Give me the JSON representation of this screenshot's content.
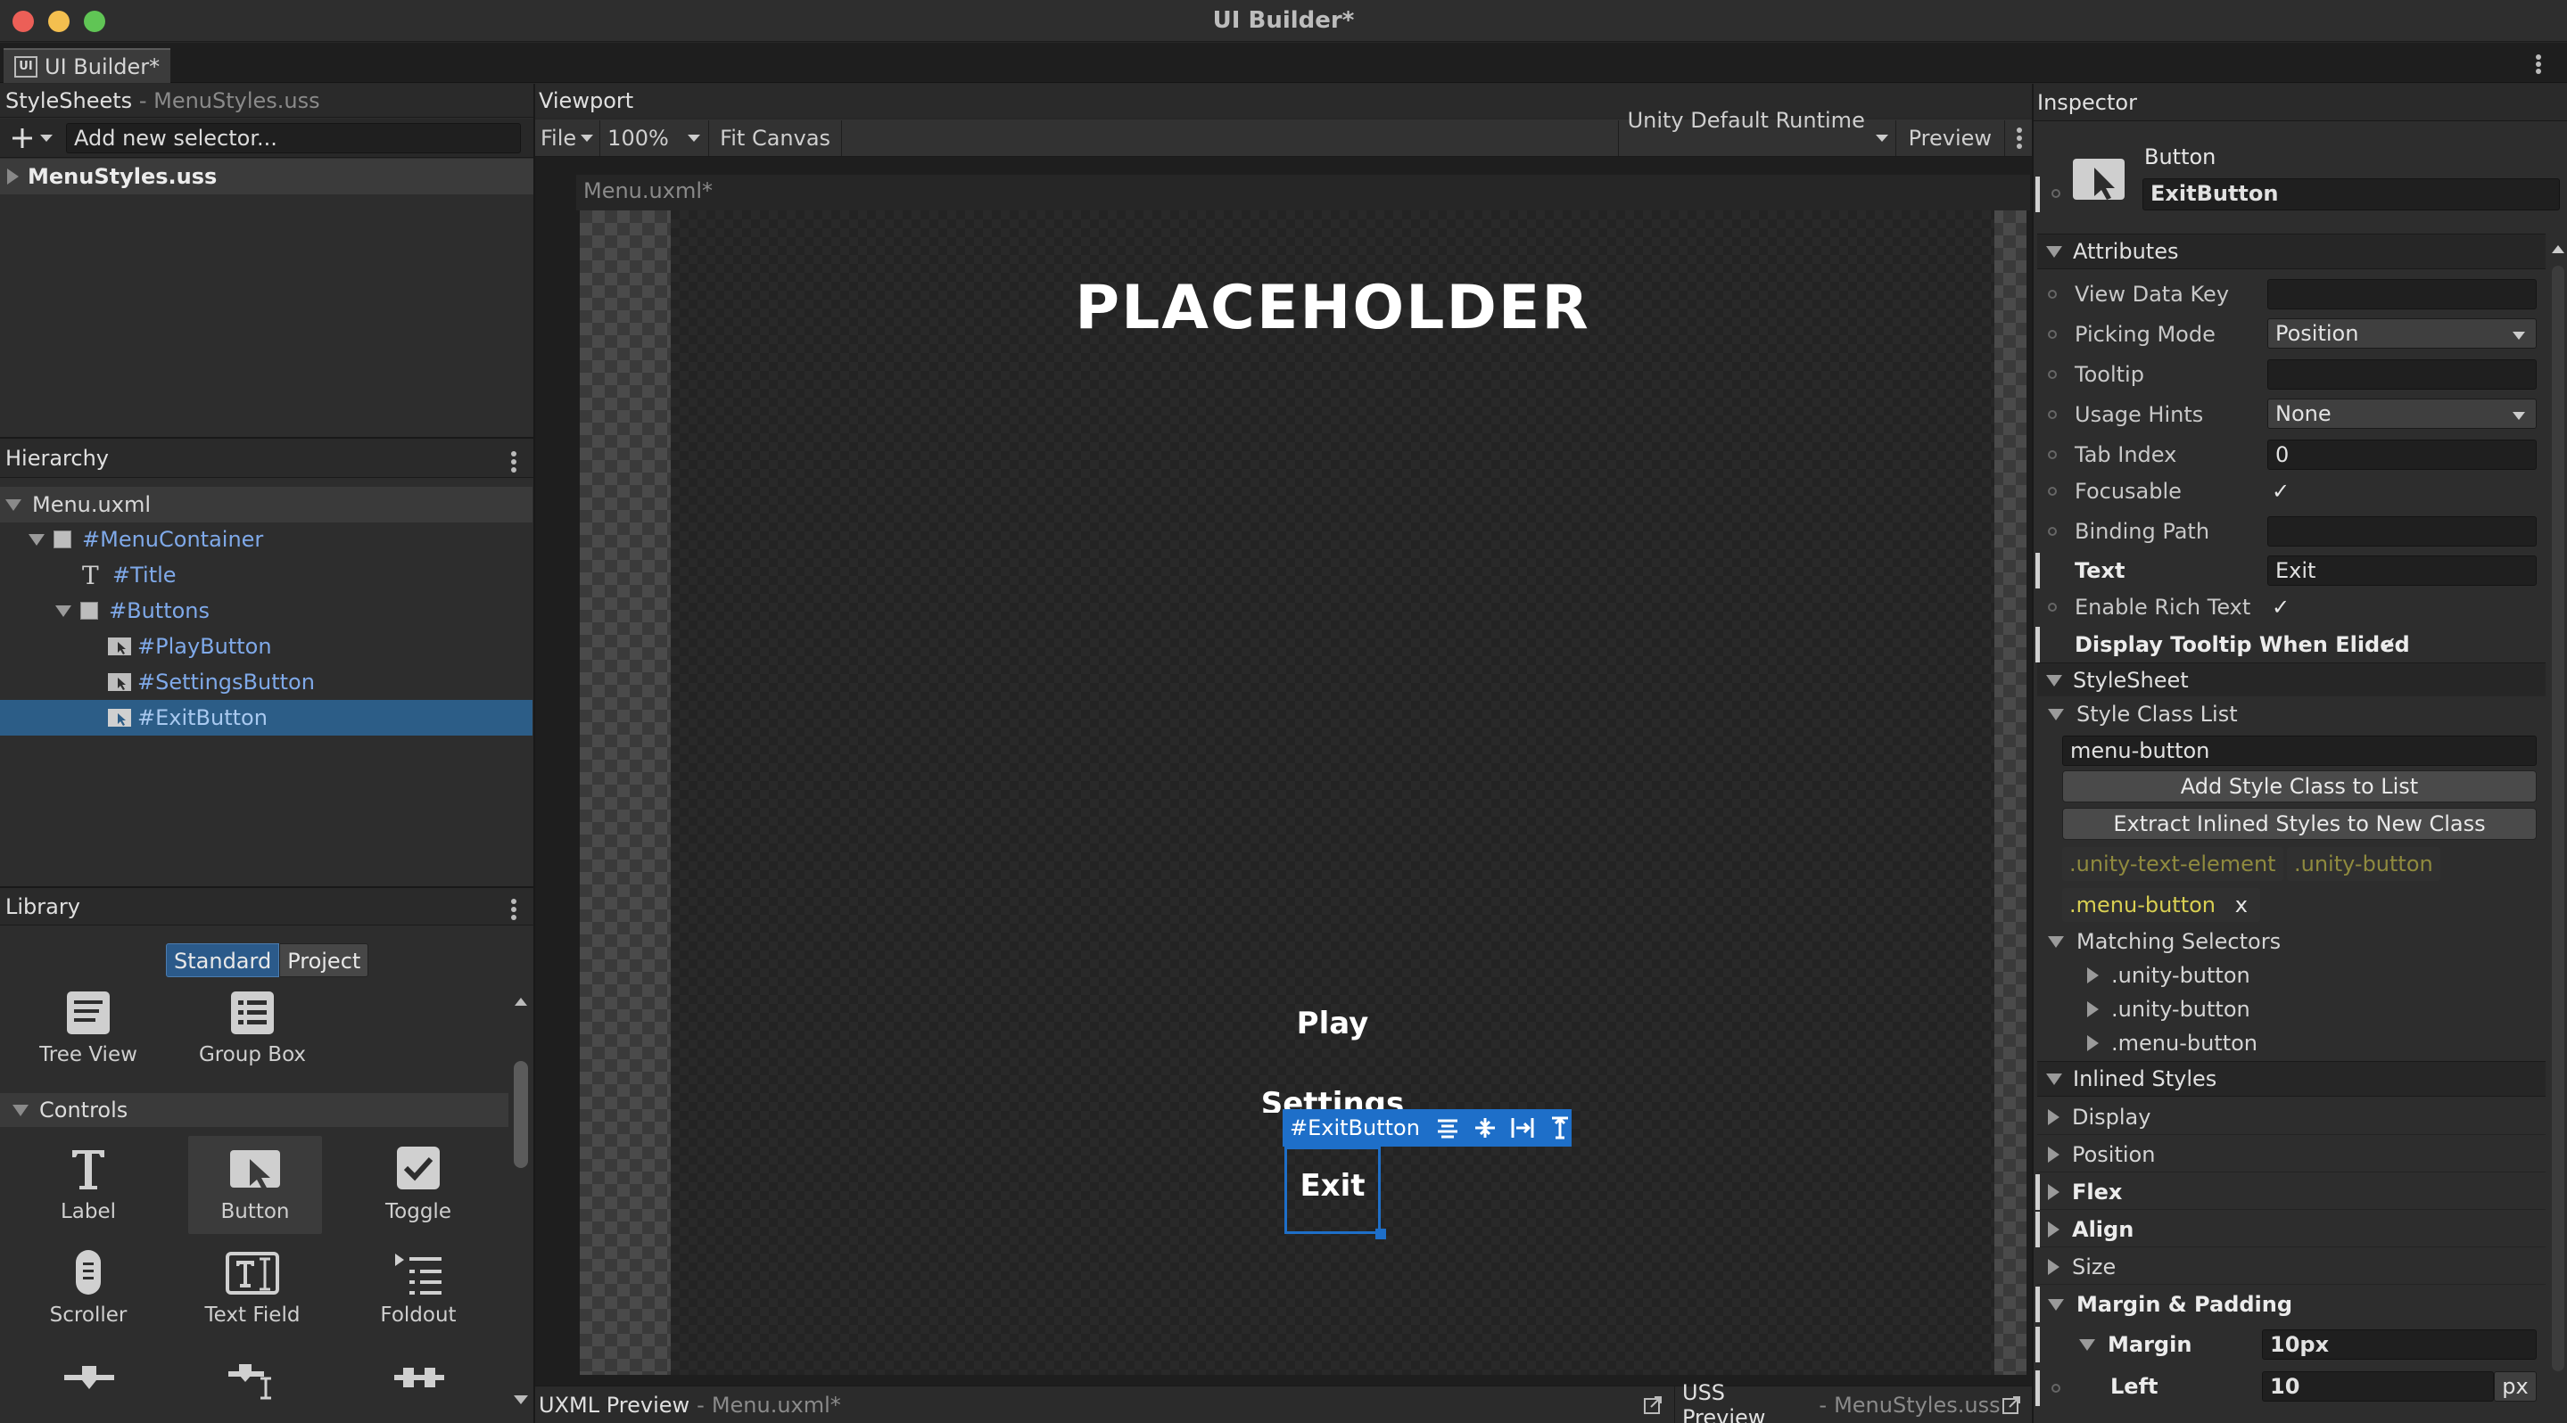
{
  "window": {
    "title": "UI Builder*",
    "tab_label": "UI Builder*",
    "tab_icon_text": "UI"
  },
  "stylesheets": {
    "title": "StyleSheets",
    "subtitle": "MenuStyles.uss",
    "selector_placeholder": "Add new selector...",
    "file": "MenuStyles.uss"
  },
  "hierarchy": {
    "title": "Hierarchy",
    "root": "Menu.uxml",
    "items": [
      {
        "label": "#MenuContainer",
        "icon": "visual-element-icon"
      },
      {
        "label": "#Title",
        "icon": "label-icon"
      },
      {
        "label": "#Buttons",
        "icon": "visual-element-icon"
      },
      {
        "label": "#PlayButton",
        "icon": "button-icon"
      },
      {
        "label": "#SettingsButton",
        "icon": "button-icon"
      },
      {
        "label": "#ExitButton",
        "icon": "button-icon",
        "selected": true
      }
    ]
  },
  "library": {
    "title": "Library",
    "tabs": [
      "Standard",
      "Project"
    ],
    "active_tab": "Standard",
    "top_items": [
      "Tree View",
      "Group Box"
    ],
    "section": "Controls",
    "controls": [
      "Label",
      "Button",
      "Toggle",
      "Scroller",
      "Text Field",
      "Foldout"
    ],
    "selected_control": "Button"
  },
  "viewport": {
    "title": "Viewport",
    "menu_file": "File",
    "zoom": "100%",
    "fit_canvas": "Fit Canvas",
    "theme": "Unity Default Runtime ...",
    "preview": "Preview",
    "canvas_title": "Menu.uxml*",
    "game_title": "PLACEHOLDER",
    "buttons": [
      "Play",
      "Settings",
      "Exit"
    ],
    "selection_label": "#ExitButton"
  },
  "bottom": {
    "uxml_label": "UXML Preview",
    "uxml_file": "Menu.uxml*",
    "uss_label": "USS Preview",
    "uss_file": "MenuStyles.uss"
  },
  "inspector": {
    "title": "Inspector",
    "element_type": "Button",
    "element_name": "ExitButton",
    "attributes_header": "Attributes",
    "attributes": {
      "view_data_key": {
        "label": "View Data Key",
        "value": ""
      },
      "picking_mode": {
        "label": "Picking Mode",
        "value": "Position"
      },
      "tooltip": {
        "label": "Tooltip",
        "value": ""
      },
      "usage_hints": {
        "label": "Usage Hints",
        "value": "None"
      },
      "tab_index": {
        "label": "Tab Index",
        "value": "0"
      },
      "focusable": {
        "label": "Focusable",
        "checked": true
      },
      "binding_path": {
        "label": "Binding Path",
        "value": ""
      },
      "text": {
        "label": "Text",
        "value": "Exit"
      },
      "enable_rich_text": {
        "label": "Enable Rich Text",
        "checked": true
      },
      "display_tooltip": {
        "label": "Display Tooltip When Elided",
        "checked": true
      }
    },
    "stylesheet_header": "StyleSheet",
    "style_class_list_header": "Style Class List",
    "class_input": "menu-button",
    "add_class_button": "Add Style Class to List",
    "extract_button": "Extract Inlined Styles to New Class",
    "classes": [
      ".unity-text-element",
      ".unity-button"
    ],
    "user_class": ".menu-button",
    "remove_class": "x",
    "matching_header": "Matching Selectors",
    "matching": [
      ".unity-button",
      ".unity-button",
      ".menu-button"
    ],
    "inlined_header": "Inlined Styles",
    "inlined": [
      "Display",
      "Position",
      "Flex",
      "Align",
      "Size"
    ],
    "margin_padding": "Margin & Padding",
    "margin": {
      "label": "Margin",
      "value": "10px"
    },
    "left": {
      "label": "Left",
      "value": "10",
      "unit": "px"
    }
  },
  "colors": {
    "selection": "#2c5d87",
    "accent": "#1e6fc9",
    "class_chip": "#b7b14b"
  }
}
